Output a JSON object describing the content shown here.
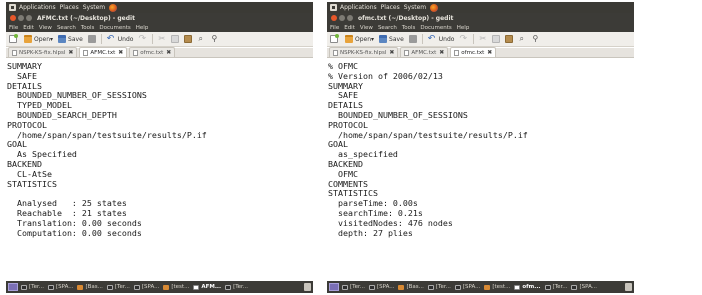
{
  "windows": [
    {
      "panel": {
        "applications": "Applications",
        "places": "Places",
        "system": "System"
      },
      "title": "AFMC.txt (~/Desktop) - gedit",
      "menu": [
        "File",
        "Edit",
        "View",
        "Search",
        "Tools",
        "Documents",
        "Help"
      ],
      "toolbar": {
        "open": "Open",
        "save": "Save",
        "undo": "Undo"
      },
      "tabs": [
        {
          "label": "NSPK-KS-fix.hlpsl",
          "active": false
        },
        {
          "label": "AFMC.txt",
          "active": true
        },
        {
          "label": "ofmc.txt",
          "active": false
        }
      ],
      "lines": [
        "SUMMARY",
        "  SAFE",
        "DETAILS",
        "  BOUNDED_NUMBER_OF_SESSIONS",
        "  TYPED_MODEL",
        "  BOUNDED_SEARCH_DEPTH",
        "PROTOCOL",
        "  /home/span/span/testsuite/results/P.if",
        "GOAL",
        "  As Specified",
        "BACKEND",
        "  CL-AtSe",
        "STATISTICS",
        "",
        "  Analysed   : 25 states",
        "  Reachable  : 21 states",
        "  Translation: 0.00 seconds",
        "  Computation: 0.00 seconds"
      ],
      "taskbar": [
        {
          "label": "[Ter...",
          "icon": "term",
          "active": false
        },
        {
          "label": "[SPA...",
          "icon": "term",
          "active": false
        },
        {
          "label": "[Bas...",
          "icon": "fold",
          "active": false
        },
        {
          "label": "[Ter...",
          "icon": "term",
          "active": false
        },
        {
          "label": "[SPA...",
          "icon": "term",
          "active": false
        },
        {
          "label": "[test...",
          "icon": "fold",
          "active": false
        },
        {
          "label": "AFM...",
          "icon": "ged",
          "active": true
        },
        {
          "label": "[Ter...",
          "icon": "term",
          "active": false
        }
      ]
    },
    {
      "panel": {
        "applications": "Applications",
        "places": "Places",
        "system": "System"
      },
      "title": "ofmc.txt (~/Desktop) - gedit",
      "menu": [
        "File",
        "Edit",
        "View",
        "Search",
        "Tools",
        "Documents",
        "Help"
      ],
      "toolbar": {
        "open": "Open",
        "save": "Save",
        "undo": "Undo"
      },
      "tabs": [
        {
          "label": "NSPK-KS-fix.hlpsl",
          "active": false
        },
        {
          "label": "AFMC.txt",
          "active": false
        },
        {
          "label": "ofmc.txt",
          "active": true
        }
      ],
      "lines": [
        "% OFMC",
        "% Version of 2006/02/13",
        "SUMMARY",
        "  SAFE",
        "DETAILS",
        "  BOUNDED_NUMBER_OF_SESSIONS",
        "PROTOCOL",
        "  /home/span/span/testsuite/results/P.if",
        "GOAL",
        "  as_specified",
        "BACKEND",
        "  OFMC",
        "COMMENTS",
        "STATISTICS",
        "  parseTime: 0.00s",
        "  searchTime: 0.21s",
        "  visitedNodes: 476 nodes",
        "  depth: 27 plies"
      ],
      "taskbar": [
        {
          "label": "[Ter...",
          "icon": "term",
          "active": false
        },
        {
          "label": "[SPA...",
          "icon": "term",
          "active": false
        },
        {
          "label": "[Bas...",
          "icon": "fold",
          "active": false
        },
        {
          "label": "[Ter...",
          "icon": "term",
          "active": false
        },
        {
          "label": "[SPA...",
          "icon": "term",
          "active": false
        },
        {
          "label": "[test...",
          "icon": "fold",
          "active": false
        },
        {
          "label": "ofm...",
          "icon": "ged",
          "active": true
        },
        {
          "label": "[Ter...",
          "icon": "term",
          "active": false
        },
        {
          "label": "[SPA...",
          "icon": "term",
          "active": false
        }
      ]
    }
  ]
}
